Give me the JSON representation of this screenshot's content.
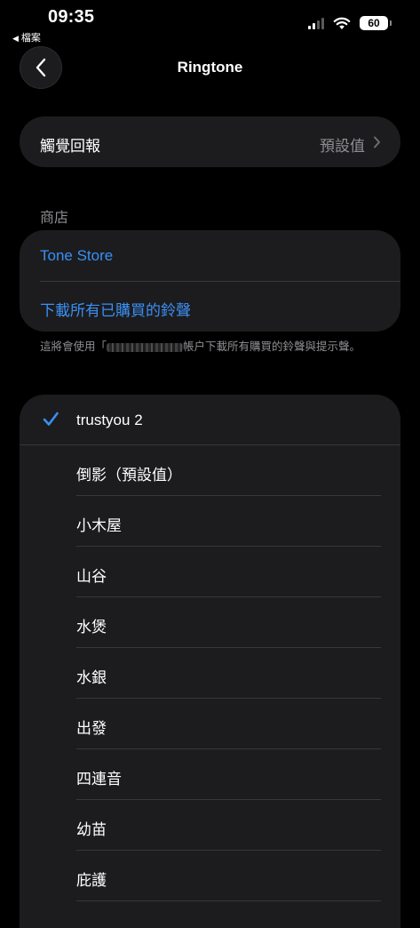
{
  "status_bar": {
    "time": "09:35",
    "back_app": "檔案",
    "battery": "60"
  },
  "nav": {
    "title": "Ringtone"
  },
  "haptics": {
    "label": "觸覺回報",
    "value": "預設值"
  },
  "store": {
    "header": "商店",
    "tone_store": "Tone Store",
    "download_all": "下載所有已購買的鈴聲",
    "note_prefix": "這將會使用「",
    "note_suffix": "帳户下載所有購買的鈴聲與提示聲。"
  },
  "ringtones": {
    "selected": "trustyou 2",
    "items": [
      "trustyou 2",
      "倒影（預設值）",
      "小木屋",
      "山谷",
      "水煲",
      "水銀",
      "出發",
      "四連音",
      "幼苗",
      "庇護"
    ]
  },
  "colors": {
    "accent": "#3a8ff5",
    "background": "#000000",
    "group": "#1c1c1e"
  }
}
